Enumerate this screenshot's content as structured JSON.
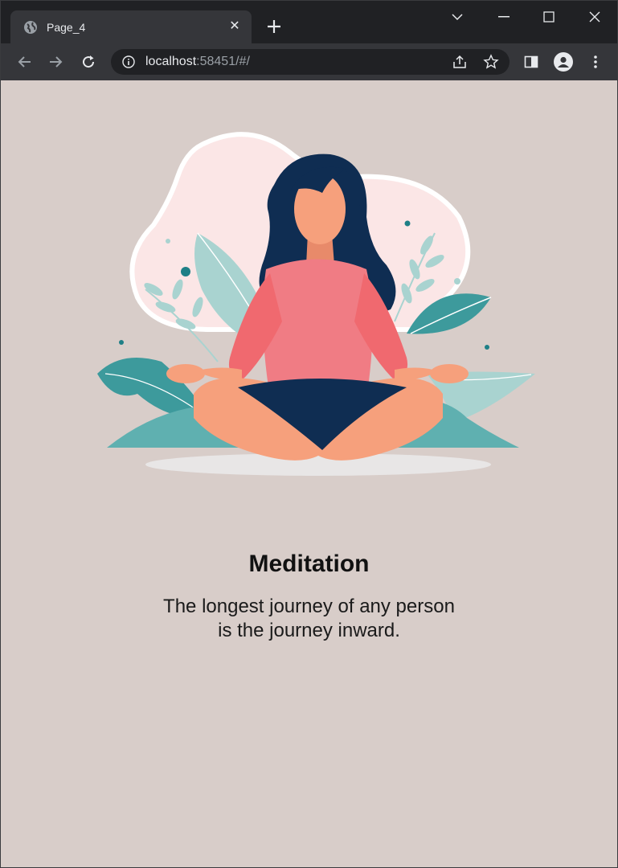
{
  "browser": {
    "tab_title": "Page_4",
    "url_host": "localhost",
    "url_rest": ":58451/#/"
  },
  "page": {
    "title": "Meditation",
    "quote_line1": "The longest journey of any person",
    "quote_line2": "is the journey inward."
  },
  "colors": {
    "page_background": "#d8cdc9",
    "shirt": "#f07c84",
    "pants": "#0f2d52",
    "hair": "#0f2d52",
    "skin": "#f6a07c",
    "leaves": "#3d9a9c"
  }
}
